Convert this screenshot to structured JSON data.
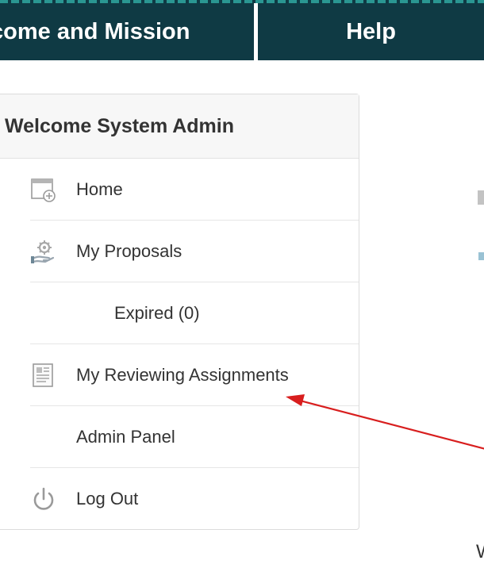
{
  "topnav": {
    "welcome_label": "lcome and Mission",
    "help_label": "Help"
  },
  "panel": {
    "title": "Welcome System Admin",
    "items": [
      {
        "label": "Home",
        "icon": "calendar-add-icon"
      },
      {
        "label": "My Proposals",
        "icon": "hand-gear-icon"
      },
      {
        "label": "Expired (0)",
        "icon": null
      },
      {
        "label": "My Reviewing Assignments",
        "icon": "document-icon"
      },
      {
        "label": "Admin Panel",
        "icon": null
      },
      {
        "label": "Log Out",
        "icon": "power-icon"
      }
    ]
  },
  "edge": {
    "partial_text": "W"
  },
  "colors": {
    "nav_bg": "#0f3a44",
    "arrow": "#d81e1e"
  }
}
